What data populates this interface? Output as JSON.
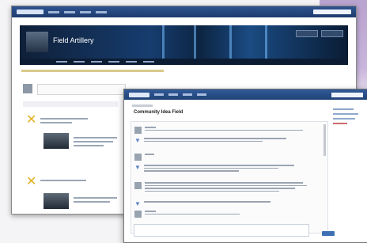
{
  "back_window": {
    "banner_title": "Field Artillery"
  },
  "front_window": {
    "topic_title": "Community Idea Field"
  },
  "colors": {
    "titlebar": "#2f5590",
    "banner": "#163d6f",
    "accent_yellow": "#e0b020",
    "link_blue": "#5e86c4"
  },
  "icons": [
    "feed-x-icon",
    "reply-arrow-icon",
    "user-avatar"
  ]
}
